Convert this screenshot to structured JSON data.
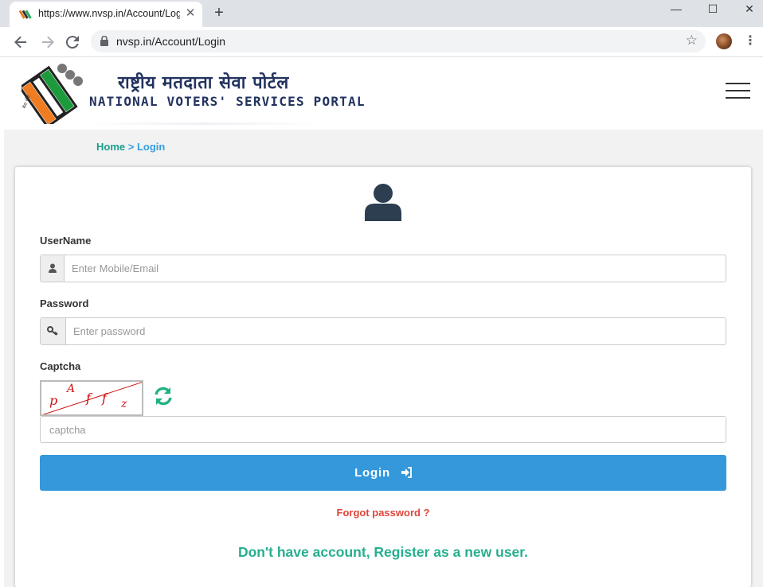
{
  "browser": {
    "tab_title": "https://www.nvsp.in/Account/Login",
    "new_tab_label": "+",
    "url": "nvsp.in/Account/Login",
    "window_controls": {
      "minimize": "—",
      "maximize": "☐",
      "close": "✕"
    },
    "icons": [
      "back-icon",
      "forward-icon",
      "reload-icon",
      "lock-icon",
      "star-icon",
      "profile-avatar",
      "kebab-icon"
    ]
  },
  "header": {
    "title_hindi": "राष्ट्रीय मतदाता सेवा पोर्टल",
    "title_english": "NATIONAL VOTERS' SERVICES PORTAL",
    "logo_text": "मेरा वोट मेरा अधिकार"
  },
  "breadcrumb": {
    "home": "Home",
    "separator": " > ",
    "current": "Login"
  },
  "form": {
    "username_label": "UserName",
    "username_placeholder": "Enter Mobile/Email",
    "password_label": "Password",
    "password_placeholder": "Enter password",
    "captcha_label": "Captcha",
    "captcha_chars": [
      "p",
      "A",
      "f",
      "f",
      "z"
    ],
    "captcha_placeholder": "captcha",
    "login_button": "Login",
    "forgot_password": "Forgot password ?",
    "register_link": "Don't have account, Register as a new user."
  },
  "colors": {
    "header_navy": "#23335f",
    "breadcrumb_home": "#1a9c8c",
    "breadcrumb_current": "#33a0e0",
    "login_button": "#3498db",
    "forgot_link": "#e0463a",
    "register_link": "#27ae8f",
    "refresh_icon": "#20b27e",
    "captcha_text": "#cc1111"
  }
}
